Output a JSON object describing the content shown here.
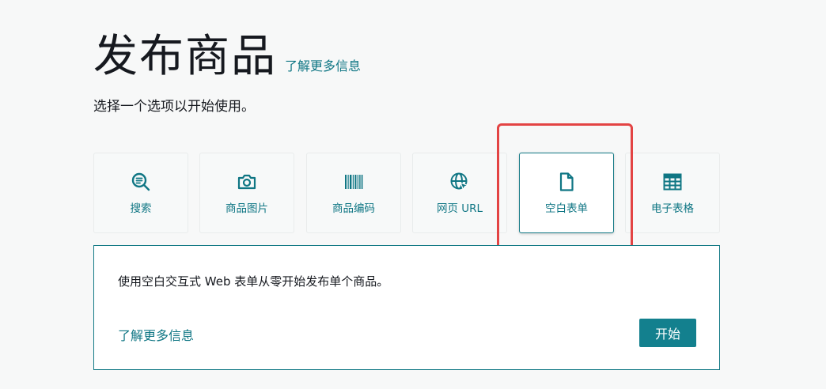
{
  "header": {
    "title": "发布商品",
    "learn_more": "了解更多信息",
    "subtitle": "选择一个选项以开始使用。"
  },
  "options": [
    {
      "key": "search",
      "label": "搜索",
      "icon": "search-list-icon"
    },
    {
      "key": "product-image",
      "label": "商品图片",
      "icon": "camera-icon"
    },
    {
      "key": "product-code",
      "label": "商品编码",
      "icon": "barcode-icon"
    },
    {
      "key": "web-url",
      "label": "网页 URL",
      "icon": "globe-cursor-icon"
    },
    {
      "key": "blank-form",
      "label": "空白表单",
      "icon": "document-icon",
      "selected": true
    },
    {
      "key": "spreadsheet",
      "label": "电子表格",
      "icon": "spreadsheet-icon"
    }
  ],
  "panel": {
    "description": "使用空白交互式 Web 表单从零开始发布单个商品。",
    "learn_more": "了解更多信息",
    "start_label": "开始"
  },
  "colors": {
    "accent": "#0f7684",
    "button": "#13808e",
    "highlight": "#e34444",
    "background": "#f7f8f8"
  }
}
